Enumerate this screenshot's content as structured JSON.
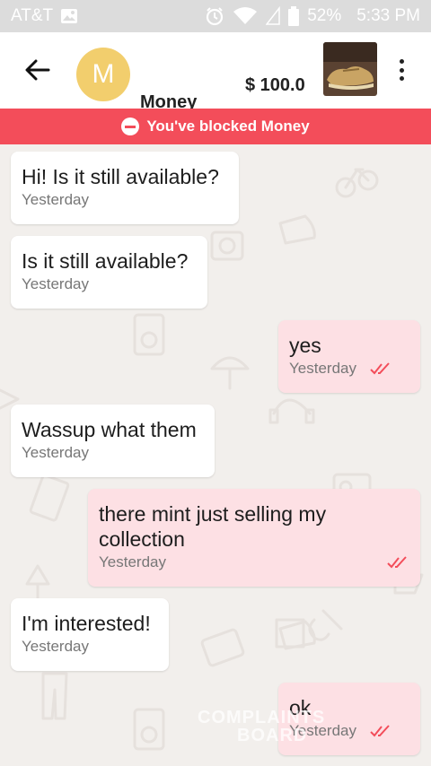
{
  "status_bar": {
    "carrier": "AT&T",
    "battery": "52%",
    "time": "5:33 PM"
  },
  "header": {
    "avatar_letter": "M",
    "contact_name": "Money",
    "price": "$ 100.0"
  },
  "banner": {
    "text": "You've blocked Money"
  },
  "messages": [
    {
      "text": "Hi! Is it still available?",
      "time": "Yesterday",
      "direction": "in"
    },
    {
      "text": "Is it still available?",
      "time": "Yesterday",
      "direction": "in"
    },
    {
      "text": "yes",
      "time": "Yesterday",
      "direction": "out"
    },
    {
      "text": "Wassup what them",
      "time": "Yesterday",
      "direction": "in"
    },
    {
      "text": "there mint just selling my collection",
      "time": "Yesterday",
      "direction": "out"
    },
    {
      "text": "I'm interested!",
      "time": "Yesterday",
      "direction": "in"
    },
    {
      "text": "ok",
      "time": "Yesterday",
      "direction": "out"
    }
  ],
  "watermark": {
    "line1": "COMPLAINTS",
    "line2": "BOARD"
  },
  "colors": {
    "accent": "#f34d5a",
    "avatar": "#f2ce6d",
    "outgoing_bubble": "#fde0e4",
    "status_bar": "#dcdcdc"
  }
}
